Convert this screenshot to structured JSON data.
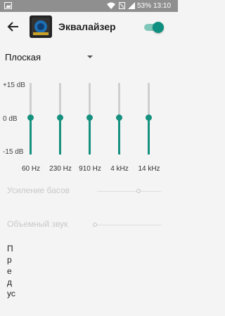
{
  "status": {
    "battery": "53%",
    "time": "13:10"
  },
  "header": {
    "title": "Эквалайзер"
  },
  "preset": {
    "selected": "Плоская"
  },
  "eq": {
    "db_top": "+15 dB",
    "db_mid": "0 dB",
    "db_bottom": "-15 dB",
    "bands": [
      {
        "freq": "60 Hz",
        "level_db": 0
      },
      {
        "freq": "230 Hz",
        "level_db": 0
      },
      {
        "freq": "910 Hz",
        "level_db": 0
      },
      {
        "freq": "4 kHz",
        "level_db": 0
      },
      {
        "freq": "14 kHz",
        "level_db": 0
      }
    ]
  },
  "settings": {
    "bass_label": "Усиление басов",
    "virtualizer_label": "Объемный звук"
  },
  "presets_footer": {
    "text": "Предус"
  },
  "colors": {
    "accent": "#16907f",
    "statusbar": "#8f8f8f"
  }
}
